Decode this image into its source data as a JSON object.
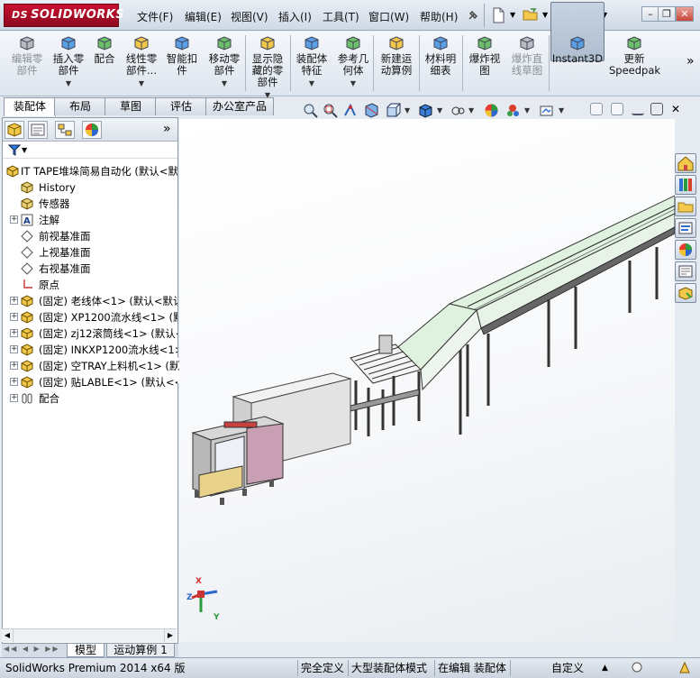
{
  "app": {
    "logo_prefix": "DS",
    "logo_text": "SOLIDWORKS"
  },
  "menu": [
    "文件(F)",
    "编辑(E)",
    "视图(V)",
    "插入(I)",
    "工具(T)",
    "窗口(W)",
    "帮助(H)"
  ],
  "ribbon": {
    "buttons": [
      {
        "label": "编辑零\n部件",
        "disabled": true,
        "icon": "edit-component-icon"
      },
      {
        "label": "插入零\n部件",
        "disabled": false,
        "icon": "insert-component-icon"
      },
      {
        "label": "配合",
        "disabled": false,
        "icon": "mate-icon"
      },
      {
        "label": "线性零\n部件...",
        "disabled": false,
        "icon": "linear-pattern-icon"
      },
      {
        "label": "智能扣\n件",
        "disabled": false,
        "icon": "smart-fastener-icon"
      },
      {
        "label": "移动零\n部件",
        "disabled": false,
        "icon": "move-component-icon"
      },
      {
        "label": "显示隐\n藏的零\n部件",
        "disabled": false,
        "icon": "show-hidden-icon"
      },
      {
        "label": "装配体\n特征",
        "disabled": false,
        "icon": "assembly-feature-icon"
      },
      {
        "label": "参考几\n何体",
        "disabled": false,
        "icon": "reference-geometry-icon"
      },
      {
        "label": "新建运\n动算例",
        "disabled": false,
        "icon": "motion-study-icon"
      },
      {
        "label": "材料明\n细表",
        "disabled": false,
        "icon": "bom-icon"
      },
      {
        "label": "爆炸视\n图",
        "disabled": false,
        "icon": "exploded-view-icon"
      },
      {
        "label": "爆炸直\n线草图",
        "disabled": true,
        "icon": "explode-line-icon"
      },
      {
        "label": "Instant3D",
        "disabled": false,
        "icon": "instant3d-icon"
      },
      {
        "label": "更新\nSpeedpak",
        "disabled": false,
        "icon": "speedpak-icon"
      }
    ],
    "more": "»"
  },
  "command_tabs": [
    "装配体",
    "布局",
    "草图",
    "评估",
    "办公室产品"
  ],
  "panel": {
    "more": "»",
    "tree": [
      {
        "label": "IT TAPE堆垛简易自动化  (默认<默",
        "icon": "assembly-icon",
        "indent": 0,
        "expand": ""
      },
      {
        "label": "History",
        "icon": "history-icon",
        "indent": 1,
        "expand": ""
      },
      {
        "label": "传感器",
        "icon": "sensor-icon",
        "indent": 1,
        "expand": ""
      },
      {
        "label": "注解",
        "icon": "annotation-icon",
        "indent": 1,
        "expand": "+"
      },
      {
        "label": "前视基准面",
        "icon": "plane-icon",
        "indent": 1,
        "expand": ""
      },
      {
        "label": "上视基准面",
        "icon": "plane-icon",
        "indent": 1,
        "expand": ""
      },
      {
        "label": "右视基准面",
        "icon": "plane-icon",
        "indent": 1,
        "expand": ""
      },
      {
        "label": "原点",
        "icon": "origin-icon",
        "indent": 1,
        "expand": ""
      },
      {
        "label": "(固定) 老线体<1> (默认<默认",
        "icon": "subassembly-icon",
        "indent": 1,
        "expand": "+"
      },
      {
        "label": "(固定) XP1200流水线<1> (默认",
        "icon": "subassembly-icon",
        "indent": 1,
        "expand": "+"
      },
      {
        "label": "(固定) zj12滚筒线<1> (默认<默",
        "icon": "subassembly-icon",
        "indent": 1,
        "expand": "+"
      },
      {
        "label": "(固定) INKXP1200流水线<1> (",
        "icon": "subassembly-icon",
        "indent": 1,
        "expand": "+"
      },
      {
        "label": "(固定) 空TRAY上料机<1> (默认",
        "icon": "subassembly-icon",
        "indent": 1,
        "expand": "+"
      },
      {
        "label": "(固定) 贴LABLE<1> (默认<<默",
        "icon": "subassembly-icon",
        "indent": 1,
        "expand": "+"
      },
      {
        "label": "配合",
        "icon": "mates-icon",
        "indent": 1,
        "expand": "+"
      }
    ]
  },
  "bottom_tabs": [
    "模型",
    "运动算例 1"
  ],
  "status": {
    "product": "SolidWorks Premium 2014 x64 版",
    "definition": "完全定义",
    "mode": "大型装配体模式",
    "editing": "在编辑 装配体",
    "custom": "自定义"
  },
  "axes": {
    "x": "X",
    "y": "Y",
    "z": "Z"
  }
}
